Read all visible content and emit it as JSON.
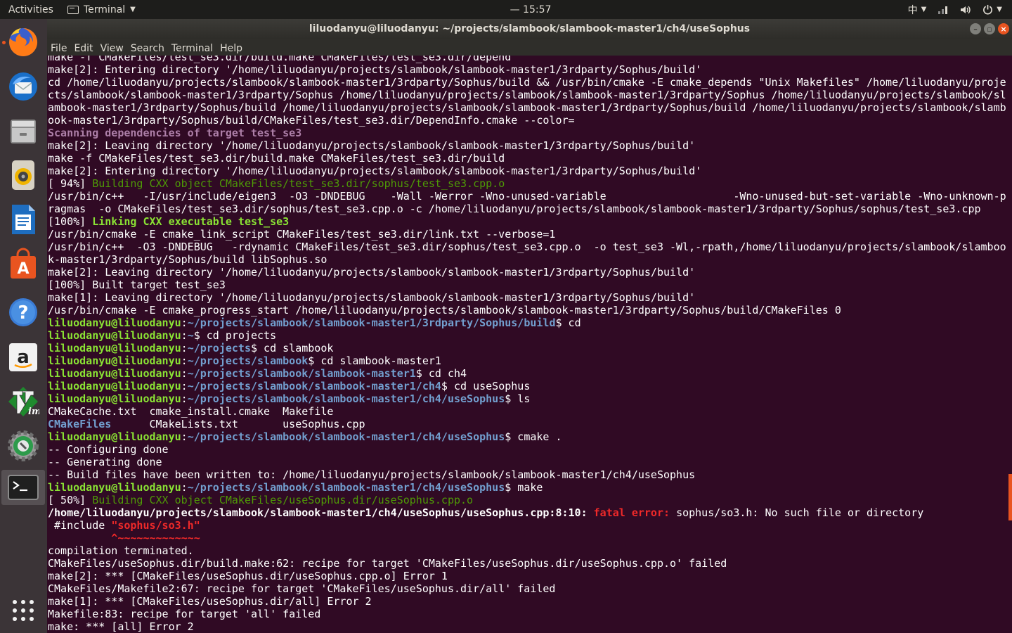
{
  "top_panel": {
    "activities": "Activities",
    "app_name": "Terminal",
    "clock": "— 15:57",
    "input_method": "中"
  },
  "window": {
    "title": "liluodanyu@liluodanyu: ~/projects/slambook/slambook-master1/ch4/useSophus",
    "menu": [
      "File",
      "Edit",
      "View",
      "Search",
      "Terminal",
      "Help"
    ]
  },
  "colors": {
    "accent": "#e95420",
    "prompt_user": "#8ae234",
    "prompt_path": "#729fcf",
    "bg": "#300a24"
  },
  "terminal": {
    "lines": [
      [
        [
          "w",
          "make -f CMakeFiles/test_se3.dir/build.make CMakeFiles/test_se3.dir/depend"
        ]
      ],
      [
        [
          "w",
          "make[2]: Entering directory '/home/liluodanyu/projects/slambook/slambook-master1/3rdparty/Sophus/build'"
        ]
      ],
      [
        [
          "w",
          "cd /home/liluodanyu/projects/slambook/slambook-master1/3rdparty/Sophus/build && /usr/bin/cmake -E cmake_depends \"Unix Makefiles\" /home/liluodanyu/proje"
        ]
      ],
      [
        [
          "w",
          "cts/slambook/slambook-master1/3rdparty/Sophus /home/liluodanyu/projects/slambook/slambook-master1/3rdparty/Sophus /home/liluodanyu/projects/slambook/sl"
        ]
      ],
      [
        [
          "w",
          "ambook-master1/3rdparty/Sophus/build /home/liluodanyu/projects/slambook/slambook-master1/3rdparty/Sophus/build /home/liluodanyu/projects/slambook/slamb"
        ]
      ],
      [
        [
          "w",
          "ook-master1/3rdparty/Sophus/build/CMakeFiles/test_se3.dir/DependInfo.cmake --color="
        ]
      ],
      [
        [
          "m",
          "Scanning dependencies of target test_se3"
        ]
      ],
      [
        [
          "w",
          "make[2]: Leaving directory '/home/liluodanyu/projects/slambook/slambook-master1/3rdparty/Sophus/build'"
        ]
      ],
      [
        [
          "w",
          "make -f CMakeFiles/test_se3.dir/build.make CMakeFiles/test_se3.dir/build"
        ]
      ],
      [
        [
          "w",
          "make[2]: Entering directory '/home/liluodanyu/projects/slambook/slambook-master1/3rdparty/Sophus/build'"
        ]
      ],
      [
        [
          "w",
          "[ 94%] "
        ],
        [
          "dg",
          "Building CXX object CMakeFiles/test_se3.dir/sophus/test_se3.cpp.o"
        ]
      ],
      [
        [
          "w",
          "/usr/bin/c++   -I/usr/include/eigen3  -O3 -DNDEBUG    -Wall -Werror -Wno-unused-variable                    -Wno-unused-but-set-variable -Wno-unknown-p"
        ]
      ],
      [
        [
          "w",
          "ragmas  -o CMakeFiles/test_se3.dir/sophus/test_se3.cpp.o -c /home/liluodanyu/projects/slambook/slambook-master1/3rdparty/Sophus/sophus/test_se3.cpp"
        ]
      ],
      [
        [
          "w",
          "[100%] "
        ],
        [
          "gb",
          "Linking CXX executable test_se3"
        ]
      ],
      [
        [
          "w",
          "/usr/bin/cmake -E cmake_link_script CMakeFiles/test_se3.dir/link.txt --verbose=1"
        ]
      ],
      [
        [
          "w",
          "/usr/bin/c++  -O3 -DNDEBUG   -rdynamic CMakeFiles/test_se3.dir/sophus/test_se3.cpp.o  -o test_se3 -Wl,-rpath,/home/liluodanyu/projects/slambook/slamboo"
        ]
      ],
      [
        [
          "w",
          "k-master1/3rdparty/Sophus/build libSophus.so"
        ]
      ],
      [
        [
          "w",
          "make[2]: Leaving directory '/home/liluodanyu/projects/slambook/slambook-master1/3rdparty/Sophus/build'"
        ]
      ],
      [
        [
          "w",
          "[100%] Built target test_se3"
        ]
      ],
      [
        [
          "w",
          "make[1]: Leaving directory '/home/liluodanyu/projects/slambook/slambook-master1/3rdparty/Sophus/build'"
        ]
      ],
      [
        [
          "w",
          "/usr/bin/cmake -E cmake_progress_start /home/liluodanyu/projects/slambook/slambook-master1/3rdparty/Sophus/build/CMakeFiles 0"
        ]
      ],
      [
        [
          "g",
          "liluodanyu@liluodanyu"
        ],
        [
          "w",
          ":"
        ],
        [
          "b",
          "~/projects/slambook/slambook-master1/3rdparty/Sophus/build"
        ],
        [
          "w",
          "$ cd"
        ]
      ],
      [
        [
          "g",
          "liluodanyu@liluodanyu"
        ],
        [
          "w",
          ":"
        ],
        [
          "b",
          "~"
        ],
        [
          "w",
          "$ cd projects"
        ]
      ],
      [
        [
          "g",
          "liluodanyu@liluodanyu"
        ],
        [
          "w",
          ":"
        ],
        [
          "b",
          "~/projects"
        ],
        [
          "w",
          "$ cd slambook"
        ]
      ],
      [
        [
          "g",
          "liluodanyu@liluodanyu"
        ],
        [
          "w",
          ":"
        ],
        [
          "b",
          "~/projects/slambook"
        ],
        [
          "w",
          "$ cd slambook-master1"
        ]
      ],
      [
        [
          "g",
          "liluodanyu@liluodanyu"
        ],
        [
          "w",
          ":"
        ],
        [
          "b",
          "~/projects/slambook/slambook-master1"
        ],
        [
          "w",
          "$ cd ch4"
        ]
      ],
      [
        [
          "g",
          "liluodanyu@liluodanyu"
        ],
        [
          "w",
          ":"
        ],
        [
          "b",
          "~/projects/slambook/slambook-master1/ch4"
        ],
        [
          "w",
          "$ cd useSophus"
        ]
      ],
      [
        [
          "g",
          "liluodanyu@liluodanyu"
        ],
        [
          "w",
          ":"
        ],
        [
          "b",
          "~/projects/slambook/slambook-master1/ch4/useSophus"
        ],
        [
          "w",
          "$ ls"
        ]
      ],
      [
        [
          "w",
          "CMakeCache.txt  cmake_install.cmake  Makefile"
        ]
      ],
      [
        [
          "b",
          "CMakeFiles"
        ],
        [
          "w",
          "      CMakeLists.txt       useSophus.cpp"
        ]
      ],
      [
        [
          "g",
          "liluodanyu@liluodanyu"
        ],
        [
          "w",
          ":"
        ],
        [
          "b",
          "~/projects/slambook/slambook-master1/ch4/useSophus"
        ],
        [
          "w",
          "$ cmake ."
        ]
      ],
      [
        [
          "w",
          "-- Configuring done"
        ]
      ],
      [
        [
          "w",
          "-- Generating done"
        ]
      ],
      [
        [
          "w",
          "-- Build files have been written to: /home/liluodanyu/projects/slambook/slambook-master1/ch4/useSophus"
        ]
      ],
      [
        [
          "g",
          "liluodanyu@liluodanyu"
        ],
        [
          "w",
          ":"
        ],
        [
          "b",
          "~/projects/slambook/slambook-master1/ch4/useSophus"
        ],
        [
          "w",
          "$ make"
        ]
      ],
      [
        [
          "w",
          "[ 50%] "
        ],
        [
          "dg",
          "Building CXX object CMakeFiles/useSophus.dir/useSophus.cpp.o"
        ]
      ],
      [
        [
          "bw",
          "/home/liluodanyu/projects/slambook/slambook-master1/ch4/useSophus/useSophus.cpp:8:10: "
        ],
        [
          "r",
          "fatal error: "
        ],
        [
          "w",
          "sophus/so3.h: No such file or directory"
        ]
      ],
      [
        [
          "w",
          " #include "
        ],
        [
          "r",
          "\"sophus/so3.h\""
        ]
      ],
      [
        [
          "r",
          "          ^~~~~~~~~~~~~~"
        ]
      ],
      [
        [
          "w",
          "compilation terminated."
        ]
      ],
      [
        [
          "w",
          "CMakeFiles/useSophus.dir/build.make:62: recipe for target 'CMakeFiles/useSophus.dir/useSophus.cpp.o' failed"
        ]
      ],
      [
        [
          "w",
          "make[2]: *** [CMakeFiles/useSophus.dir/useSophus.cpp.o] Error 1"
        ]
      ],
      [
        [
          "w",
          "CMakeFiles/Makefile2:67: recipe for target 'CMakeFiles/useSophus.dir/all' failed"
        ]
      ],
      [
        [
          "w",
          "make[1]: *** [CMakeFiles/useSophus.dir/all] Error 2"
        ]
      ],
      [
        [
          "w",
          "Makefile:83: recipe for target 'all' failed"
        ]
      ],
      [
        [
          "w",
          "make: *** [all] Error 2"
        ]
      ]
    ]
  }
}
